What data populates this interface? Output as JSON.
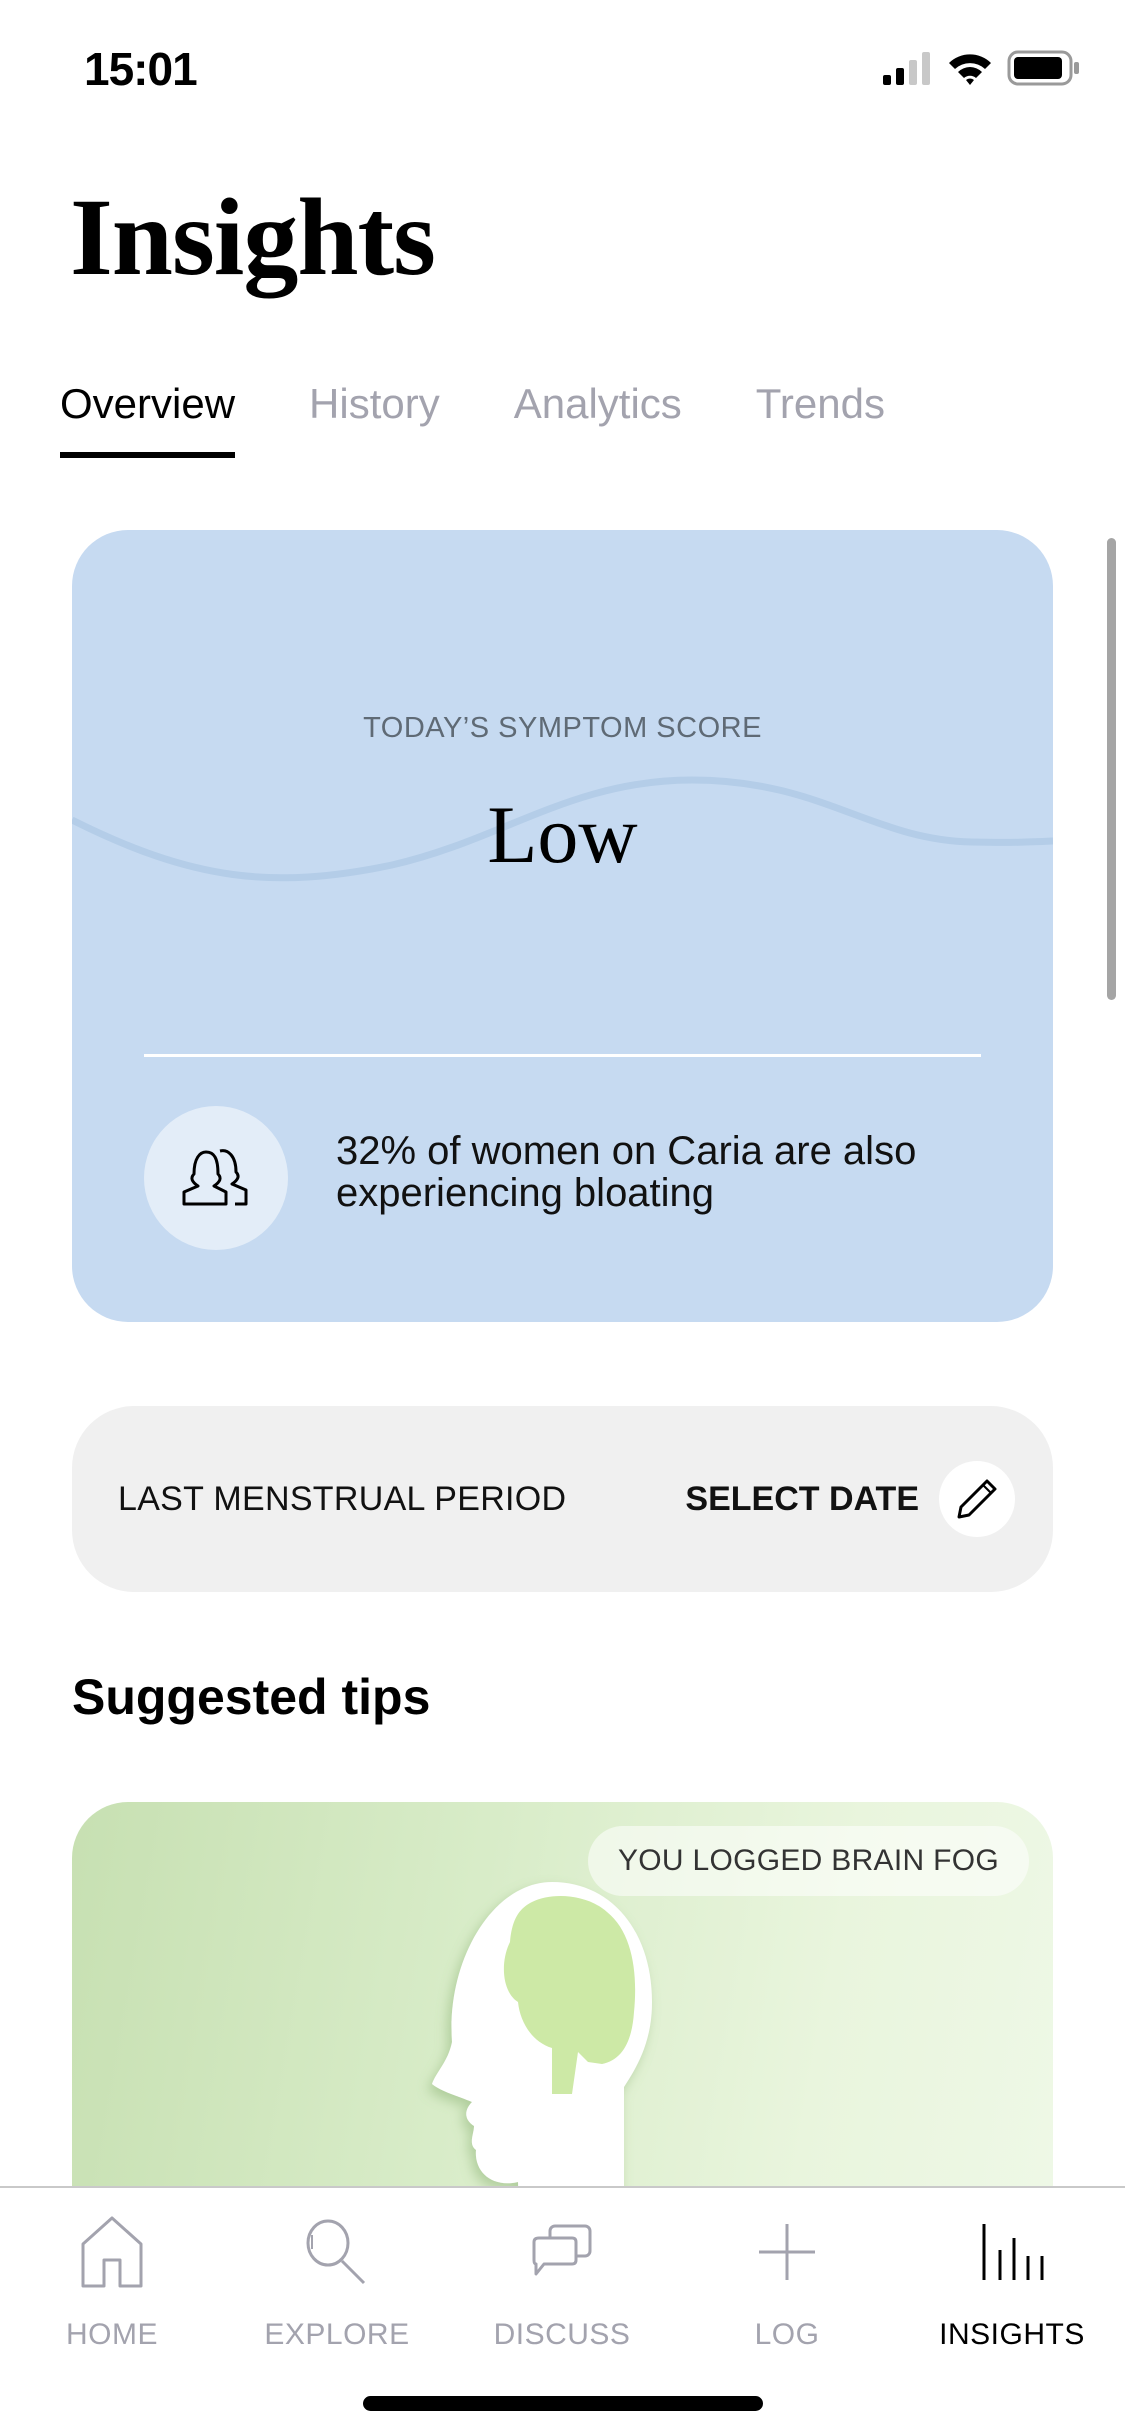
{
  "status_bar": {
    "time": "15:01",
    "icons": [
      "signal-icon",
      "wifi-icon",
      "battery-icon"
    ]
  },
  "header": {
    "title": "Insights"
  },
  "tabs": [
    {
      "label": "Overview",
      "active": true
    },
    {
      "label": "History",
      "active": false
    },
    {
      "label": "Analytics",
      "active": false
    },
    {
      "label": "Trends",
      "active": false
    }
  ],
  "symptom_card": {
    "label": "TODAY’S SYMPTOM SCORE",
    "value": "Low",
    "stat_icon": "two-women-icon",
    "stat_text": "32% of women on Caria are also experiencing bloating",
    "background_color": "#c6daf1"
  },
  "period_card": {
    "label": "LAST MENSTRUAL PERIOD",
    "action_label": "SELECT DATE",
    "action_icon": "pencil-icon"
  },
  "suggested_tips": {
    "title": "Suggested tips",
    "cards": [
      {
        "badge": "YOU LOGGED BRAIN FOG",
        "image": "head-brain-illustration"
      }
    ]
  },
  "bottom_nav": {
    "items": [
      {
        "label": "HOME",
        "icon": "home-icon",
        "active": false
      },
      {
        "label": "EXPLORE",
        "icon": "search-icon",
        "active": false
      },
      {
        "label": "DISCUSS",
        "icon": "chat-bubbles-icon",
        "active": false
      },
      {
        "label": "LOG",
        "icon": "plus-icon",
        "active": false
      },
      {
        "label": "INSIGHTS",
        "icon": "bar-chart-icon",
        "active": true
      }
    ]
  }
}
